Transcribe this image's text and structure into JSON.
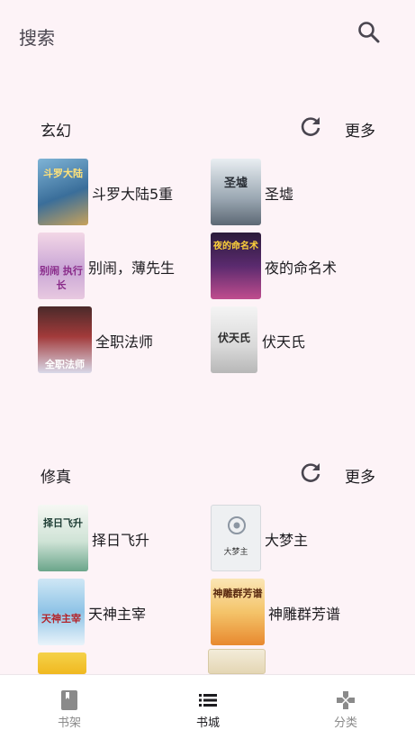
{
  "topbar": {
    "search_label": "搜索",
    "search_icon": "search-icon"
  },
  "sections": [
    {
      "title": "玄幻",
      "more_label": "更多",
      "books": [
        {
          "title": "斗罗大陆5重",
          "cover_text": "斗罗大陆"
        },
        {
          "title": "圣墟",
          "cover_text": "圣墟"
        },
        {
          "title": "别闹，薄先生",
          "cover_text": "别闹 执行长"
        },
        {
          "title": "夜的命名术",
          "cover_text": "夜的命名术"
        },
        {
          "title": "全职法师",
          "cover_text": "全职法师"
        },
        {
          "title": "伏天氏",
          "cover_text": "伏天氏"
        }
      ]
    },
    {
      "title": "修真",
      "more_label": "更多",
      "books": [
        {
          "title": "择日飞升",
          "cover_text": "择日飞升"
        },
        {
          "title": "大梦主",
          "cover_text": "大梦主"
        },
        {
          "title": "天神主宰",
          "cover_text": "天神主宰"
        },
        {
          "title": "神雕群芳谱",
          "cover_text": "神雕群芳谱"
        }
      ]
    }
  ],
  "nav": [
    {
      "label": "书架",
      "icon": "book-icon"
    },
    {
      "label": "书城",
      "icon": "list-icon"
    },
    {
      "label": "分类",
      "icon": "gamepad-icon"
    }
  ],
  "colors": {
    "background": "#fdf3f7",
    "nav_background": "#ffffff",
    "text": "#1c1b1f",
    "muted": "#8a8a8a"
  }
}
